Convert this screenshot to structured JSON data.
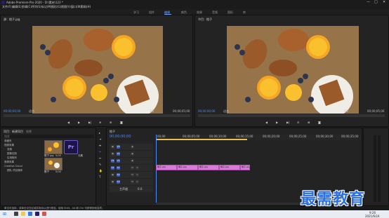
{
  "app": {
    "title": "Adobe Premiere Pro 2020 - D:\\素材\\123 *"
  },
  "window_controls": [
    "—",
    "□",
    "✕"
  ],
  "menu": [
    "文件(F)",
    "编辑(E)",
    "剪辑(C)",
    "序列(S)",
    "标记(M)",
    "图形(G)",
    "视图(V)",
    "窗口(W)",
    "帮助(H)"
  ],
  "workspaces": {
    "items": [
      "学习",
      "组件",
      "编辑",
      "颜色",
      "效果",
      "音频",
      "图形",
      "库"
    ],
    "active_index": 2
  },
  "source_monitor": {
    "title": "源：橙子.jpg",
    "timecode_left": "00;00;00;00",
    "fit": "适合",
    "scale": "1/2",
    "timecode_right": "00;00;05;00"
  },
  "program_monitor": {
    "title": "节目：橙子",
    "timecode_left": "00;00;00;00",
    "fit": "适合",
    "scale": "1/2",
    "timecode_right": "00;00;05;00"
  },
  "project_panel": {
    "tabs": [
      "项目：新建项目",
      "效果"
    ],
    "search_placeholder": "搜索",
    "tree": [
      "收藏夹",
      "视频效果",
      "变换",
      "图像控制",
      "实用程序",
      "音频效果",
      "Creative Cloud",
      "团队 项目媒体"
    ],
    "thumbnails": [
      {
        "label": "橙子.jpg",
        "duration": "5;00"
      },
      {
        "label": "橙子",
        "duration": "5;00"
      },
      {
        "label": "元素",
        "duration": ""
      }
    ],
    "pr_badge": "Pr"
  },
  "timeline": {
    "tab": "橙子",
    "timecode": "00;00;00;00",
    "ruler": [
      "00;00",
      "00;00;05;00",
      "00;00;10;00",
      "00;00;15;00",
      "00;00;20;00",
      "00;00;25;00",
      "00;00;30;00",
      "00;00;35;00"
    ],
    "tracks": [
      "V3",
      "V2",
      "V1",
      "A1",
      "A2",
      "A3",
      "主声道"
    ],
    "master_value": "0.0",
    "clips": [
      "橙子.jpg",
      "橙子.jpg",
      "橙子.jpg",
      "橙子.jpg",
      "橙子.jpg"
    ]
  },
  "status_bar": "单击可选择，或单击空白区域并拖动以进行框选。使用 Shift、Alt 和 Ctrl 可获得其他选项。",
  "taskbar": {
    "time": "9:26",
    "date": "2021/6/24"
  },
  "watermark": "最需教育",
  "colors": {
    "accent": "#4d8dff",
    "clip": "#d87ad8",
    "watermark": "#2c6fe0"
  }
}
